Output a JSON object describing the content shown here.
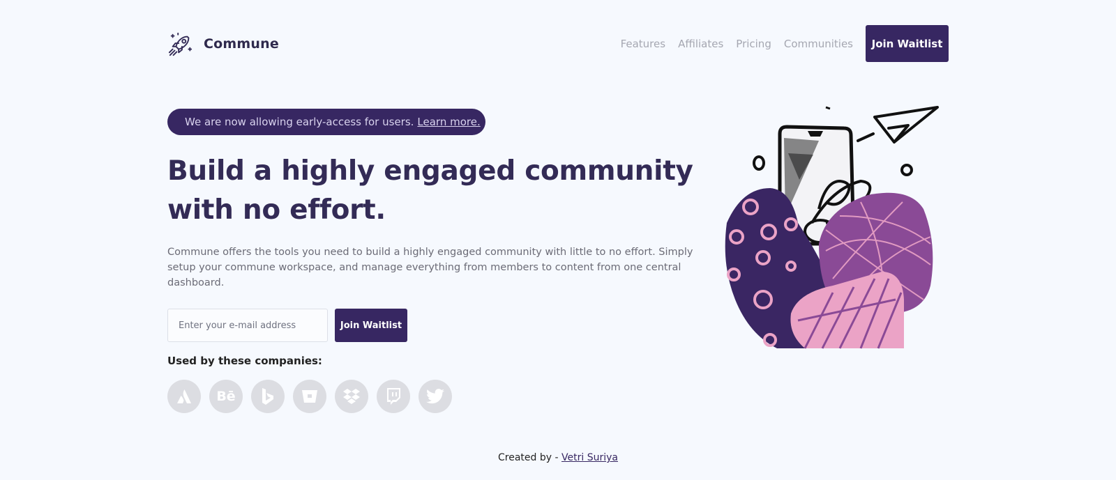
{
  "nav": {
    "brand": "Commune",
    "links": [
      "Features",
      "Affiliates",
      "Pricing",
      "Communities"
    ],
    "cta": "Join Waitlist"
  },
  "announcement": {
    "text": "We are now allowing early-access for users.",
    "link": "Learn more."
  },
  "hero": {
    "title": "Build a highly engaged community with no effort.",
    "description": "Commune offers the tools you need to build a highly engaged community with little to no effort. Simply setup your commune workspace, and manage everything from members to content from one central dashboard.",
    "email_placeholder": "Enter your e-mail address",
    "cta": "Join Waitlist"
  },
  "companies": {
    "label": "Used by these companies:",
    "logos": [
      "atlassian-icon",
      "behance-icon",
      "bing-icon",
      "bitbucket-icon",
      "dropbox-icon",
      "twitch-icon",
      "twitter-icon"
    ],
    "behance_text": "Bē"
  },
  "footer": {
    "prefix": "Created by - ",
    "author": "Vetri Suriya"
  },
  "colors": {
    "primary": "#372762",
    "background": "#f6f9fe",
    "logo_gray": "#dcdde2",
    "illustration_pink": "#eba3c6",
    "illustration_purple": "#8a4a96"
  }
}
